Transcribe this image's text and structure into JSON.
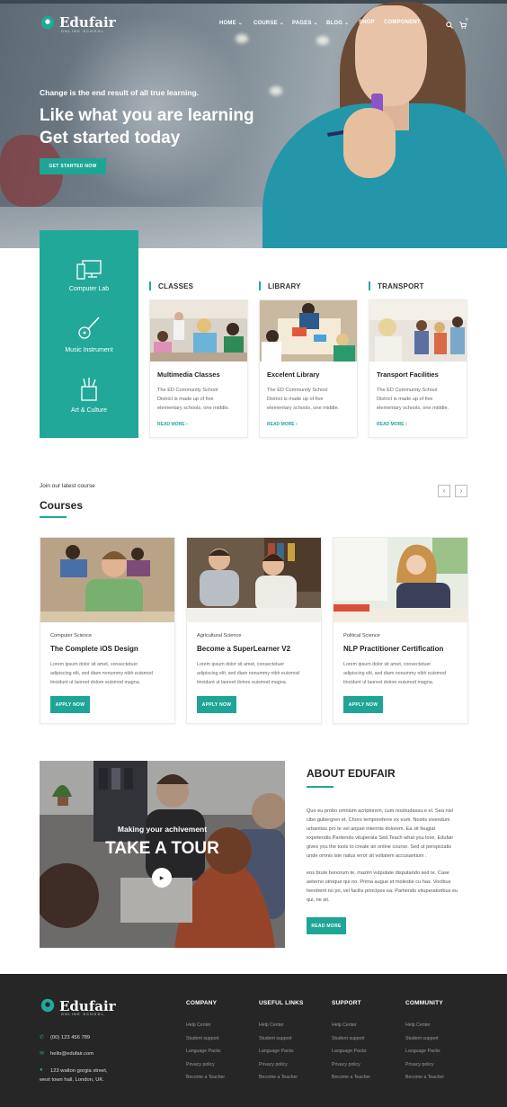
{
  "brand": {
    "name": "Edufair",
    "tagline": "ONLINE SCHOOL"
  },
  "nav": {
    "items": [
      {
        "label": "HOME",
        "dropdown": true
      },
      {
        "label": "COURSE",
        "dropdown": true
      },
      {
        "label": "PAGES",
        "dropdown": true
      },
      {
        "label": "BLOG",
        "dropdown": true
      },
      {
        "label": "SHOP",
        "dropdown": false
      },
      {
        "label": "COMPONENT",
        "dropdown": false
      }
    ],
    "cart_count": "0",
    "icons": [
      "search-icon",
      "cart-icon",
      "chevron-down-icon"
    ]
  },
  "hero": {
    "kicker": "Change is the end result of all true learning.",
    "title_line1": "Like what you are learning",
    "title_line2": "Get started today",
    "cta": "GET STARTED NOW"
  },
  "features_panel": {
    "items": [
      {
        "label": "Computer Lab",
        "icon": "computer-icon"
      },
      {
        "label": "Music Instrument",
        "icon": "guitar-icon"
      },
      {
        "label": "Art & Culture",
        "icon": "art-supplies-icon"
      }
    ]
  },
  "facilities": [
    {
      "heading": "CLASSES",
      "title": "Multimedia Classes",
      "text_lines": [
        "The ED Community School",
        "District is made up of five",
        "elementary schools, one middle."
      ],
      "link": "READ MORE"
    },
    {
      "heading": "LIBRARY",
      "title": "Excelent Library",
      "text_lines": [
        "The ED Community School",
        "District is made up of five",
        "elementary schools, one middle."
      ],
      "link": "READ MORE"
    },
    {
      "heading": "TRANSPORT",
      "title": "Transport Facilities",
      "text_lines": [
        "The ED Community School",
        "District is made up of five",
        "elementary schools, one middle."
      ],
      "link": "READ MORE"
    }
  ],
  "courses": {
    "kicker": "Join our latest course",
    "title": "Courses",
    "prev": "‹",
    "next": "›",
    "items": [
      {
        "category": "Computer Science",
        "title": "The Complete iOS Design",
        "text_lines": [
          "Lorem ipsum dolor sit amet, consectetuer",
          "adipiscing elit, sed diam nonummy nibh euismod",
          "tincidunt ut laoreet dolore euismod magna."
        ],
        "button": "APPLY NOW"
      },
      {
        "category": "Agricultural Science",
        "title": "Become a SuperLearner V2",
        "text_lines": [
          "Lorem ipsum dolor sit amet, consectetuer",
          "adipiscing elit, sed diam nonummy nibh euismod",
          "tincidunt ut laoreet dolore euismod magna."
        ],
        "button": "APPLY NOW"
      },
      {
        "category": "Political Science",
        "title": "NLP Practitioner Certification",
        "text_lines": [
          "Lorem ipsum dolor sit amet, consectetuer",
          "adipiscing elit, sed diam nonummy nibh euismod",
          "tincidunt ut laoreet dolore euismod magna."
        ],
        "button": "APPLY NOW"
      }
    ]
  },
  "about": {
    "video_kicker": "Making your achivement",
    "video_title": "TAKE A TOUR",
    "title": "ABOUT EDUFAIR",
    "para1_lines": [
      "Quo eu probo omnium acriptorem, cum nostrudassu e el. Sea nisl",
      "cibo gubergren et. Choro temporeferre ex eum. Nostis vivendum",
      "urbanitas pro te vel anpari intermis dolorem. Ea sit feugiat",
      "expetendis.Partiendo vituperata Sed.Teach what you love. Edufair",
      "gives you the tools to create an online course. Sed ut perspiciatis",
      "unde omnis iste natus error sit voltatem accusantium ."
    ],
    "para2_lines": [
      "eos brute bonorum te, mazim vulputate disputando sed te. Case",
      "aeterno utroque qui no. Prima augue et molestie cu has. Vocibus",
      "hendrerit no pri, vel facilis principes ea. Partiendo vituperatoribus eu",
      "qui, ne sit."
    ],
    "button": "READ MORE"
  },
  "footer": {
    "phone": "(00) 123 456 789",
    "email": "hello@edufair.com",
    "address_line1": "123 walton gorgia street,",
    "address_line2": "west town hall, London, UK.",
    "columns": [
      {
        "heading": "COMPANY",
        "links": [
          "Help Center",
          "Student support",
          "Language Packs",
          "Privacy policy",
          "Become a Teacher"
        ]
      },
      {
        "heading": "USEFUL LINKS",
        "links": [
          "Help Center",
          "Student support",
          "Language Packs",
          "Privacy policy",
          "Become a Teacher"
        ]
      },
      {
        "heading": "SUPPORT",
        "links": [
          "Help Center",
          "Student support",
          "Language Packs",
          "Privacy policy",
          "Become a Teacher"
        ]
      },
      {
        "heading": "COMMUNITY",
        "links": [
          "Help Center",
          "Student support",
          "Language Packs",
          "Privacy policy",
          "Become a Teacher"
        ]
      }
    ]
  },
  "colors": {
    "accent": "#21a899",
    "footer_bg": "#262626",
    "hero_shirt": "#2396a9"
  }
}
